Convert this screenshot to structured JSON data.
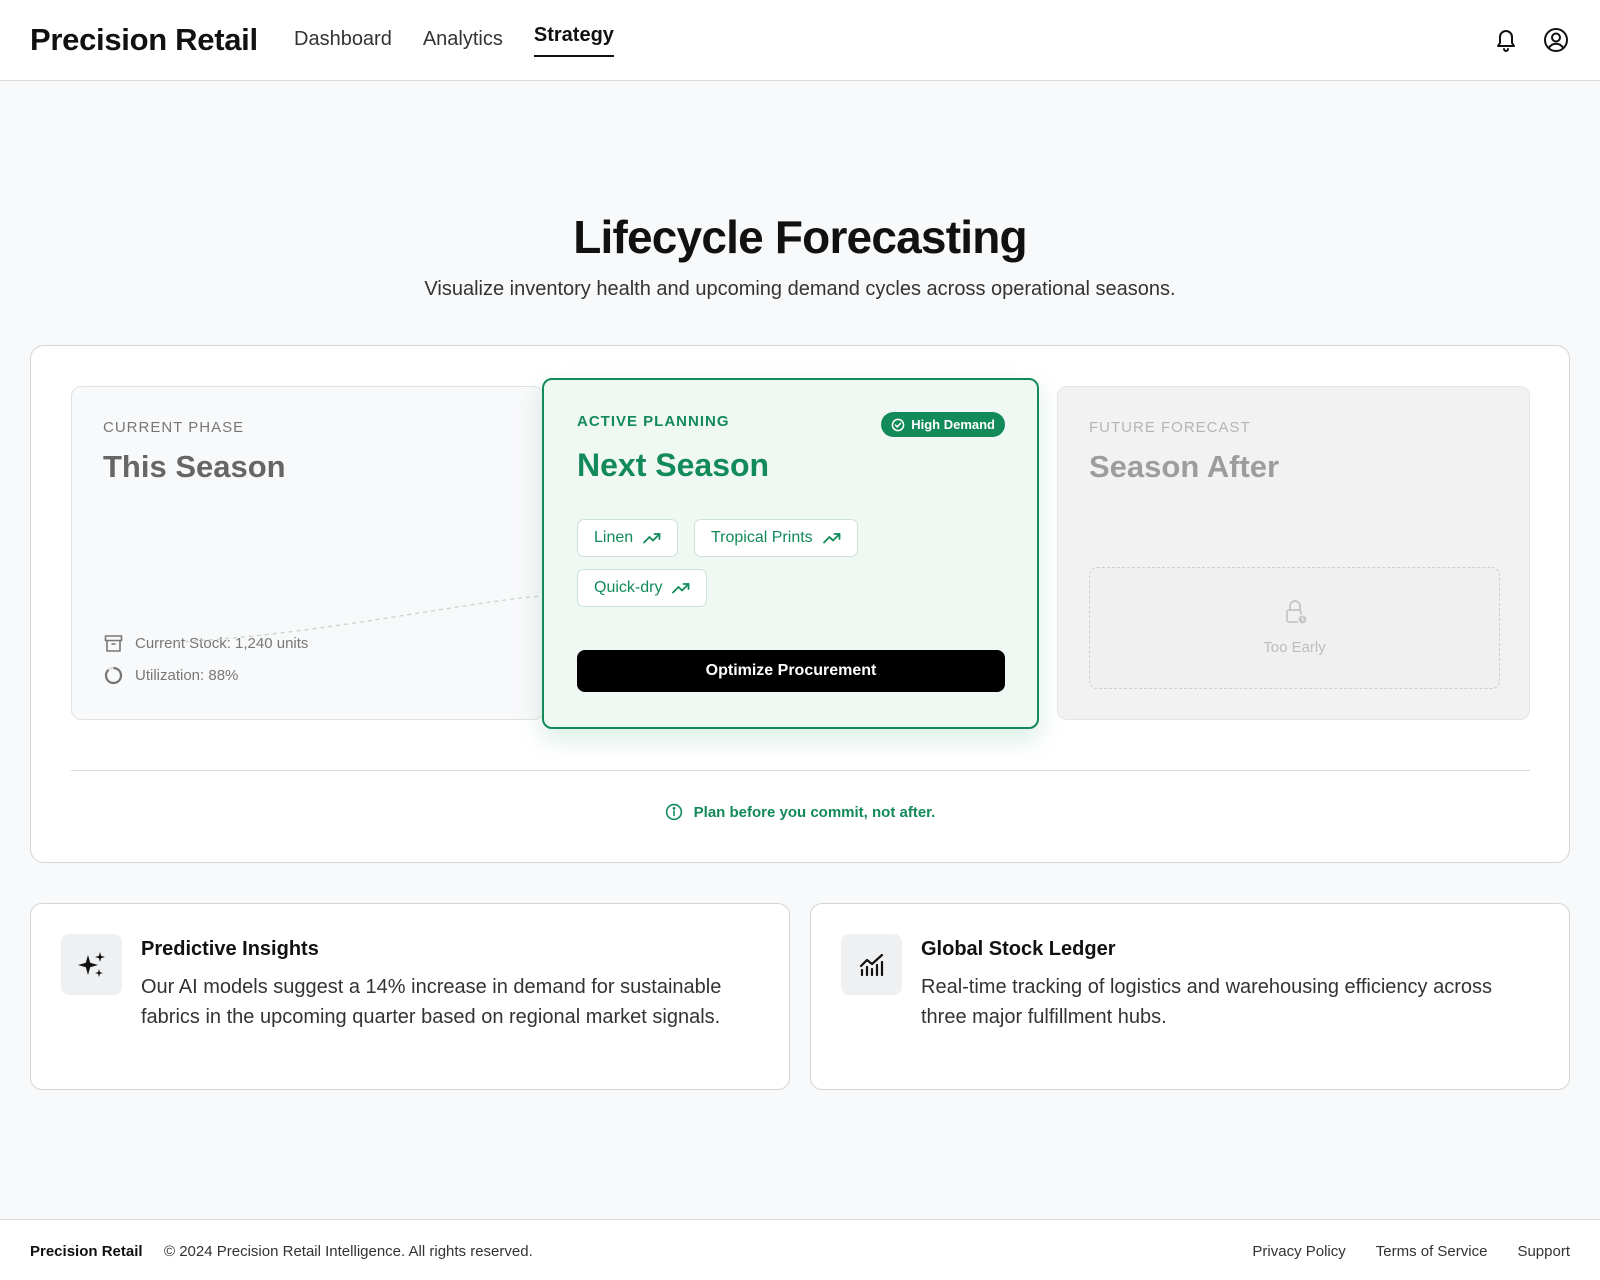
{
  "header": {
    "brand": "Precision Retail",
    "nav": [
      {
        "label": "Dashboard",
        "active": false
      },
      {
        "label": "Analytics",
        "active": false
      },
      {
        "label": "Strategy",
        "active": true
      }
    ],
    "icons": [
      "bell-icon",
      "user-circle-icon"
    ]
  },
  "hero": {
    "title": "Lifecycle Forecasting",
    "subtitle": "Visualize inventory health and upcoming demand cycles across operational seasons."
  },
  "lifecycle": {
    "current": {
      "kicker": "CURRENT PHASE",
      "title": "This Season",
      "stock": "Current Stock: 1,240 units",
      "utilization": "Utilization: 88%",
      "utilization_value": 88
    },
    "active": {
      "kicker": "ACTIVE PLANNING",
      "badge": "High Demand",
      "title": "Next Season",
      "chips": [
        "Linen",
        "Tropical Prints",
        "Quick-dry"
      ],
      "cta": "Optimize Procurement"
    },
    "future": {
      "kicker": "FUTURE FORECAST",
      "title": "Season After",
      "locked_label": "Too Early"
    },
    "tip": "Plan before you commit, not after."
  },
  "cards": [
    {
      "icon": "sparkles-icon",
      "title": "Predictive Insights",
      "body": "Our AI models suggest a 14% increase in demand for sustainable fabrics in the upcoming quarter based on regional market signals."
    },
    {
      "icon": "bar-chart-trend-icon",
      "title": "Global Stock Ledger",
      "body": "Real-time tracking of logistics and warehousing efficiency across three major fulfillment hubs."
    }
  ],
  "footer": {
    "brand": "Precision Retail",
    "copyright": "© 2024 Precision Retail Intelligence. All rights reserved.",
    "links": [
      "Privacy Policy",
      "Terms of Service",
      "Support"
    ]
  },
  "colors": {
    "accent": "#128a5a",
    "accent_soft": "#f0f8f4",
    "cta": "#000000",
    "background": "#f8f9fa"
  }
}
